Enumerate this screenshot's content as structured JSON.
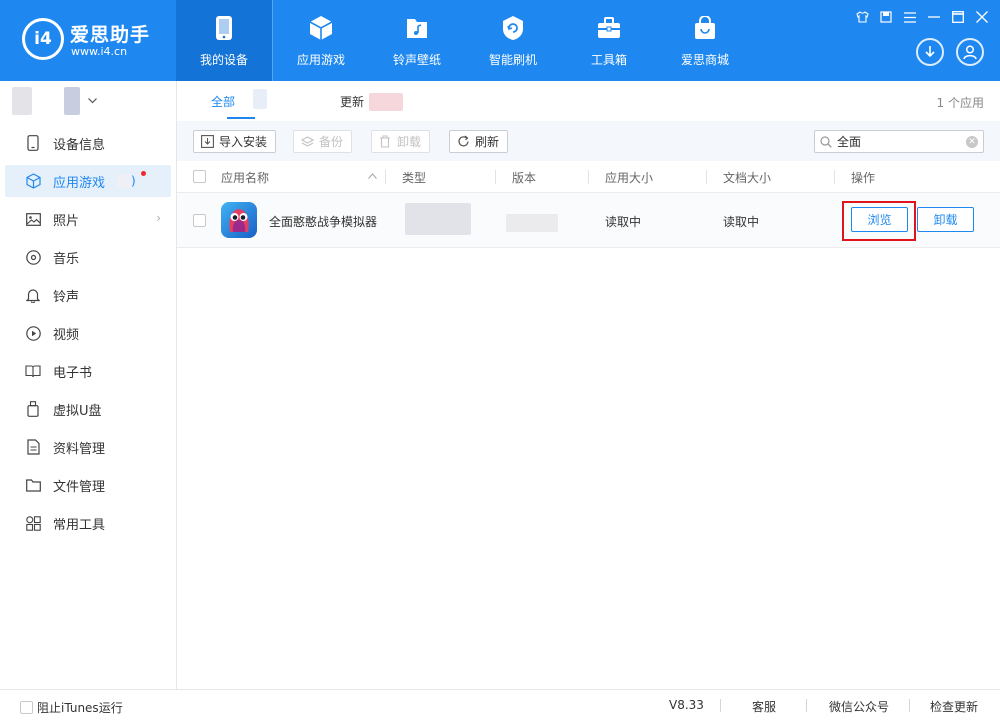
{
  "brand": {
    "name": "爱思助手",
    "url": "www.i4.cn",
    "mark": "i4"
  },
  "nav": [
    {
      "label": "我的设备",
      "icon": "phone-icon",
      "active": true
    },
    {
      "label": "应用游戏",
      "icon": "cube-icon",
      "active": false
    },
    {
      "label": "铃声壁纸",
      "icon": "music-folder-icon",
      "active": false
    },
    {
      "label": "智能刷机",
      "icon": "shield-refresh-icon",
      "active": false
    },
    {
      "label": "工具箱",
      "icon": "toolbox-icon",
      "active": false
    },
    {
      "label": "爱思商城",
      "icon": "shopping-bag-icon",
      "active": false
    }
  ],
  "window_controls": [
    "shirt-icon",
    "note-icon",
    "menu-icon",
    "minimize-icon",
    "maximize-icon",
    "close-icon"
  ],
  "header_actions": [
    "download-icon",
    "user-icon"
  ],
  "sidebar": {
    "items": [
      {
        "label": "设备信息",
        "icon": "phone-outline-icon"
      },
      {
        "label": "应用游戏",
        "icon": "cube-outline-icon",
        "active": true,
        "suffix": ")"
      },
      {
        "label": "照片",
        "icon": "image-icon",
        "chevron": "›"
      },
      {
        "label": "音乐",
        "icon": "music-disc-icon"
      },
      {
        "label": "铃声",
        "icon": "bell-icon"
      },
      {
        "label": "视频",
        "icon": "play-circle-icon"
      },
      {
        "label": "电子书",
        "icon": "book-icon"
      },
      {
        "label": "虚拟U盘",
        "icon": "usb-icon"
      },
      {
        "label": "资料管理",
        "icon": "file-doc-icon"
      },
      {
        "label": "文件管理",
        "icon": "folder-icon"
      },
      {
        "label": "常用工具",
        "icon": "grid-icon"
      }
    ]
  },
  "tabs": [
    {
      "label": "全部",
      "active": true
    },
    {
      "label": "更新",
      "active": false
    }
  ],
  "app_count": "1 个应用",
  "toolbar": {
    "import": "导入安装",
    "backup": "备份",
    "uninstall": "卸载",
    "refresh": "刷新",
    "search_value": "全面"
  },
  "table": {
    "headers": {
      "name": "应用名称",
      "type": "类型",
      "version": "版本",
      "app_size": "应用大小",
      "doc_size": "文档大小",
      "action": "操作"
    },
    "rows": [
      {
        "name": "全面憨憨战争模拟器",
        "app_size": "读取中",
        "doc_size": "读取中",
        "browse": "浏览",
        "uninstall": "卸载"
      }
    ]
  },
  "status": {
    "block_itunes": "阻止iTunes运行",
    "version": "V8.33",
    "support": "客服",
    "wechat": "微信公众号",
    "check_update": "检查更新"
  },
  "colors": {
    "brand_blue": "#1e88f0",
    "nav_active": "#1473d6",
    "highlight_red": "#e0141e"
  }
}
